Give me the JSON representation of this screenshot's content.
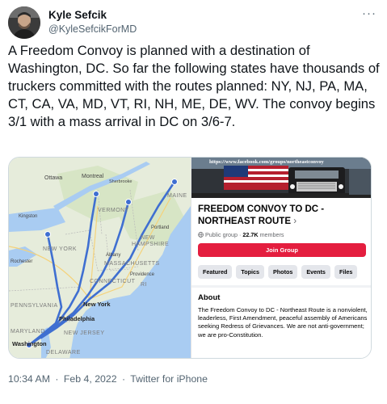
{
  "author": {
    "name": "Kyle Sefcik",
    "handle": "@KyleSefcikForMD"
  },
  "tweet": {
    "text": "A Freedom Convoy is planned with a destination of Washington, DC. So far the following states have thousands of truckers committed with the routes planned: NY, NJ, PA, MA, CT, CA, VA, MD, VT, RI, NH, ME, DE, WV. The convoy begins 3/1 with a mass arrival in DC on 3/6-7."
  },
  "map": {
    "labels": {
      "ottawa": "Ottawa",
      "montreal": "Montreal",
      "sherbrooke": "Sherbrooke",
      "kingston": "Kingston",
      "vermont": "VERMONT",
      "maine": "MAINE",
      "portland": "Portland",
      "new_hampshire": "NEW HAMPSHIRE",
      "albany": "Albany",
      "new_york_state": "NEW YORK",
      "rochester": "Rochester",
      "massachusetts": "MASSACHUSETTS",
      "providence": "Providence",
      "connecticut": "CONNECTICUT",
      "ri": "RI",
      "new_york_city": "New York",
      "pennsylvania": "PENNSYLVANIA",
      "philadelphia": "Philadelphia",
      "maryland": "MARYLAND",
      "new_jersey": "NEW JERSEY",
      "washington": "Washington",
      "delaware": "DELAWARE"
    },
    "colors": {
      "land": "#e6ecdb",
      "water": "#a9ccf2",
      "route": "#3f6fd1",
      "road": "#f5d27a"
    }
  },
  "facebook": {
    "cover_url": "https://www.facebook.com/groups/northeastconvoy",
    "group_title": "FREEDOM CONVOY TO DC - NORTHEAST ROUTE",
    "chevron": "›",
    "privacy": "Public group",
    "dot": "·",
    "members_count": "22.7K",
    "members_label": "members",
    "join_label": "Join Group",
    "tabs": [
      "Featured",
      "Topics",
      "Photos",
      "Events",
      "Files"
    ],
    "about_heading": "About",
    "about_text": "The Freedom Convoy to DC - Northeast Route is a nonviolent, leaderless, First Amendment, peaceful assembly of Americans seeking Redress of Grievances. We are not anti-government; we are pro-Constitution."
  },
  "meta": {
    "time": "10:34 AM",
    "date": "Feb 4, 2022",
    "source": "Twitter for iPhone",
    "separator": "·"
  },
  "icons": {
    "more": "more-dots-icon",
    "globe": "globe-icon"
  }
}
